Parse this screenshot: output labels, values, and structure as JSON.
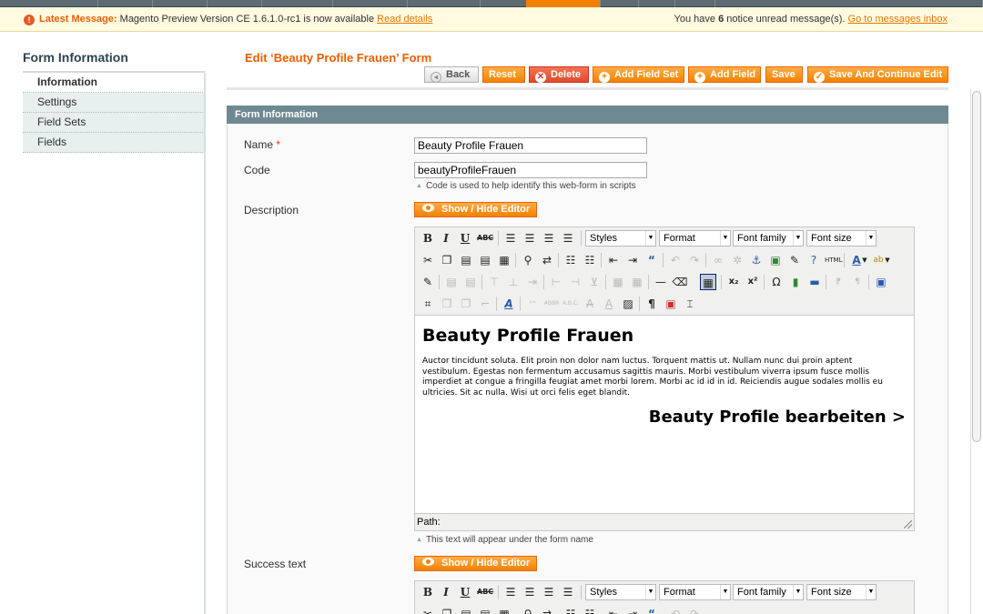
{
  "message_bar": {
    "prefix": "Latest Message:",
    "text": "Magento Preview Version CE 1.6.1.0-rc1 is now available",
    "link": "Read details",
    "notice_pre": "You have",
    "notice_count": "6",
    "notice_post": "notice unread message(s).",
    "notice_link": "Go to messages inbox"
  },
  "sidebar": {
    "title": "Form Information",
    "tabs": [
      {
        "label": "Information",
        "active": true
      },
      {
        "label": "Settings",
        "active": false
      },
      {
        "label": "Field Sets",
        "active": false
      },
      {
        "label": "Fields",
        "active": false
      }
    ]
  },
  "header": {
    "title": "Edit ‘Beauty Profile Frauen’ Form",
    "buttons": {
      "back": "Back",
      "reset": "Reset",
      "delete": "Delete",
      "add_field_set": "Add Field Set",
      "add_field": "Add Field",
      "save": "Save",
      "save_continue": "Save And Continue Edit"
    }
  },
  "fieldset": {
    "title": "Form Information",
    "name_label": "Name",
    "name_required": "*",
    "name_value": "Beauty Profile Frauen",
    "code_label": "Code",
    "code_value": "beautyProfileFrauen",
    "code_note": "Code is used to help identify this web-form in scripts",
    "description_label": "Description",
    "toggle_label": "Show / Hide Editor",
    "success_label": "Success text",
    "description_note": "This text will appear under the form name"
  },
  "editor": {
    "styles": "Styles",
    "format": "Format",
    "font_family": "Font family",
    "font_size": "Font size",
    "content_heading": "Beauty Profile Frauen",
    "content_paragraph": "Auctor tincidunt soluta. Elit proin non dolor nam luctus. Torquent mattis ut. Nullam nunc dui proin aptent vestibulum. Egestas non fermentum accusamus sagittis mauris. Morbi vestibulum viverra ipsum fusce mollis imperdiet at congue a fringilla feugiat amet morbi lorem. Morbi ac id id in id. Reiciendis augue sodales mollis eu ultricies. Sit ac nulla. Wisi ut orci felis eget blandit.",
    "content_link": "Beauty Profile bearbeiten >",
    "path_label": "Path:"
  }
}
